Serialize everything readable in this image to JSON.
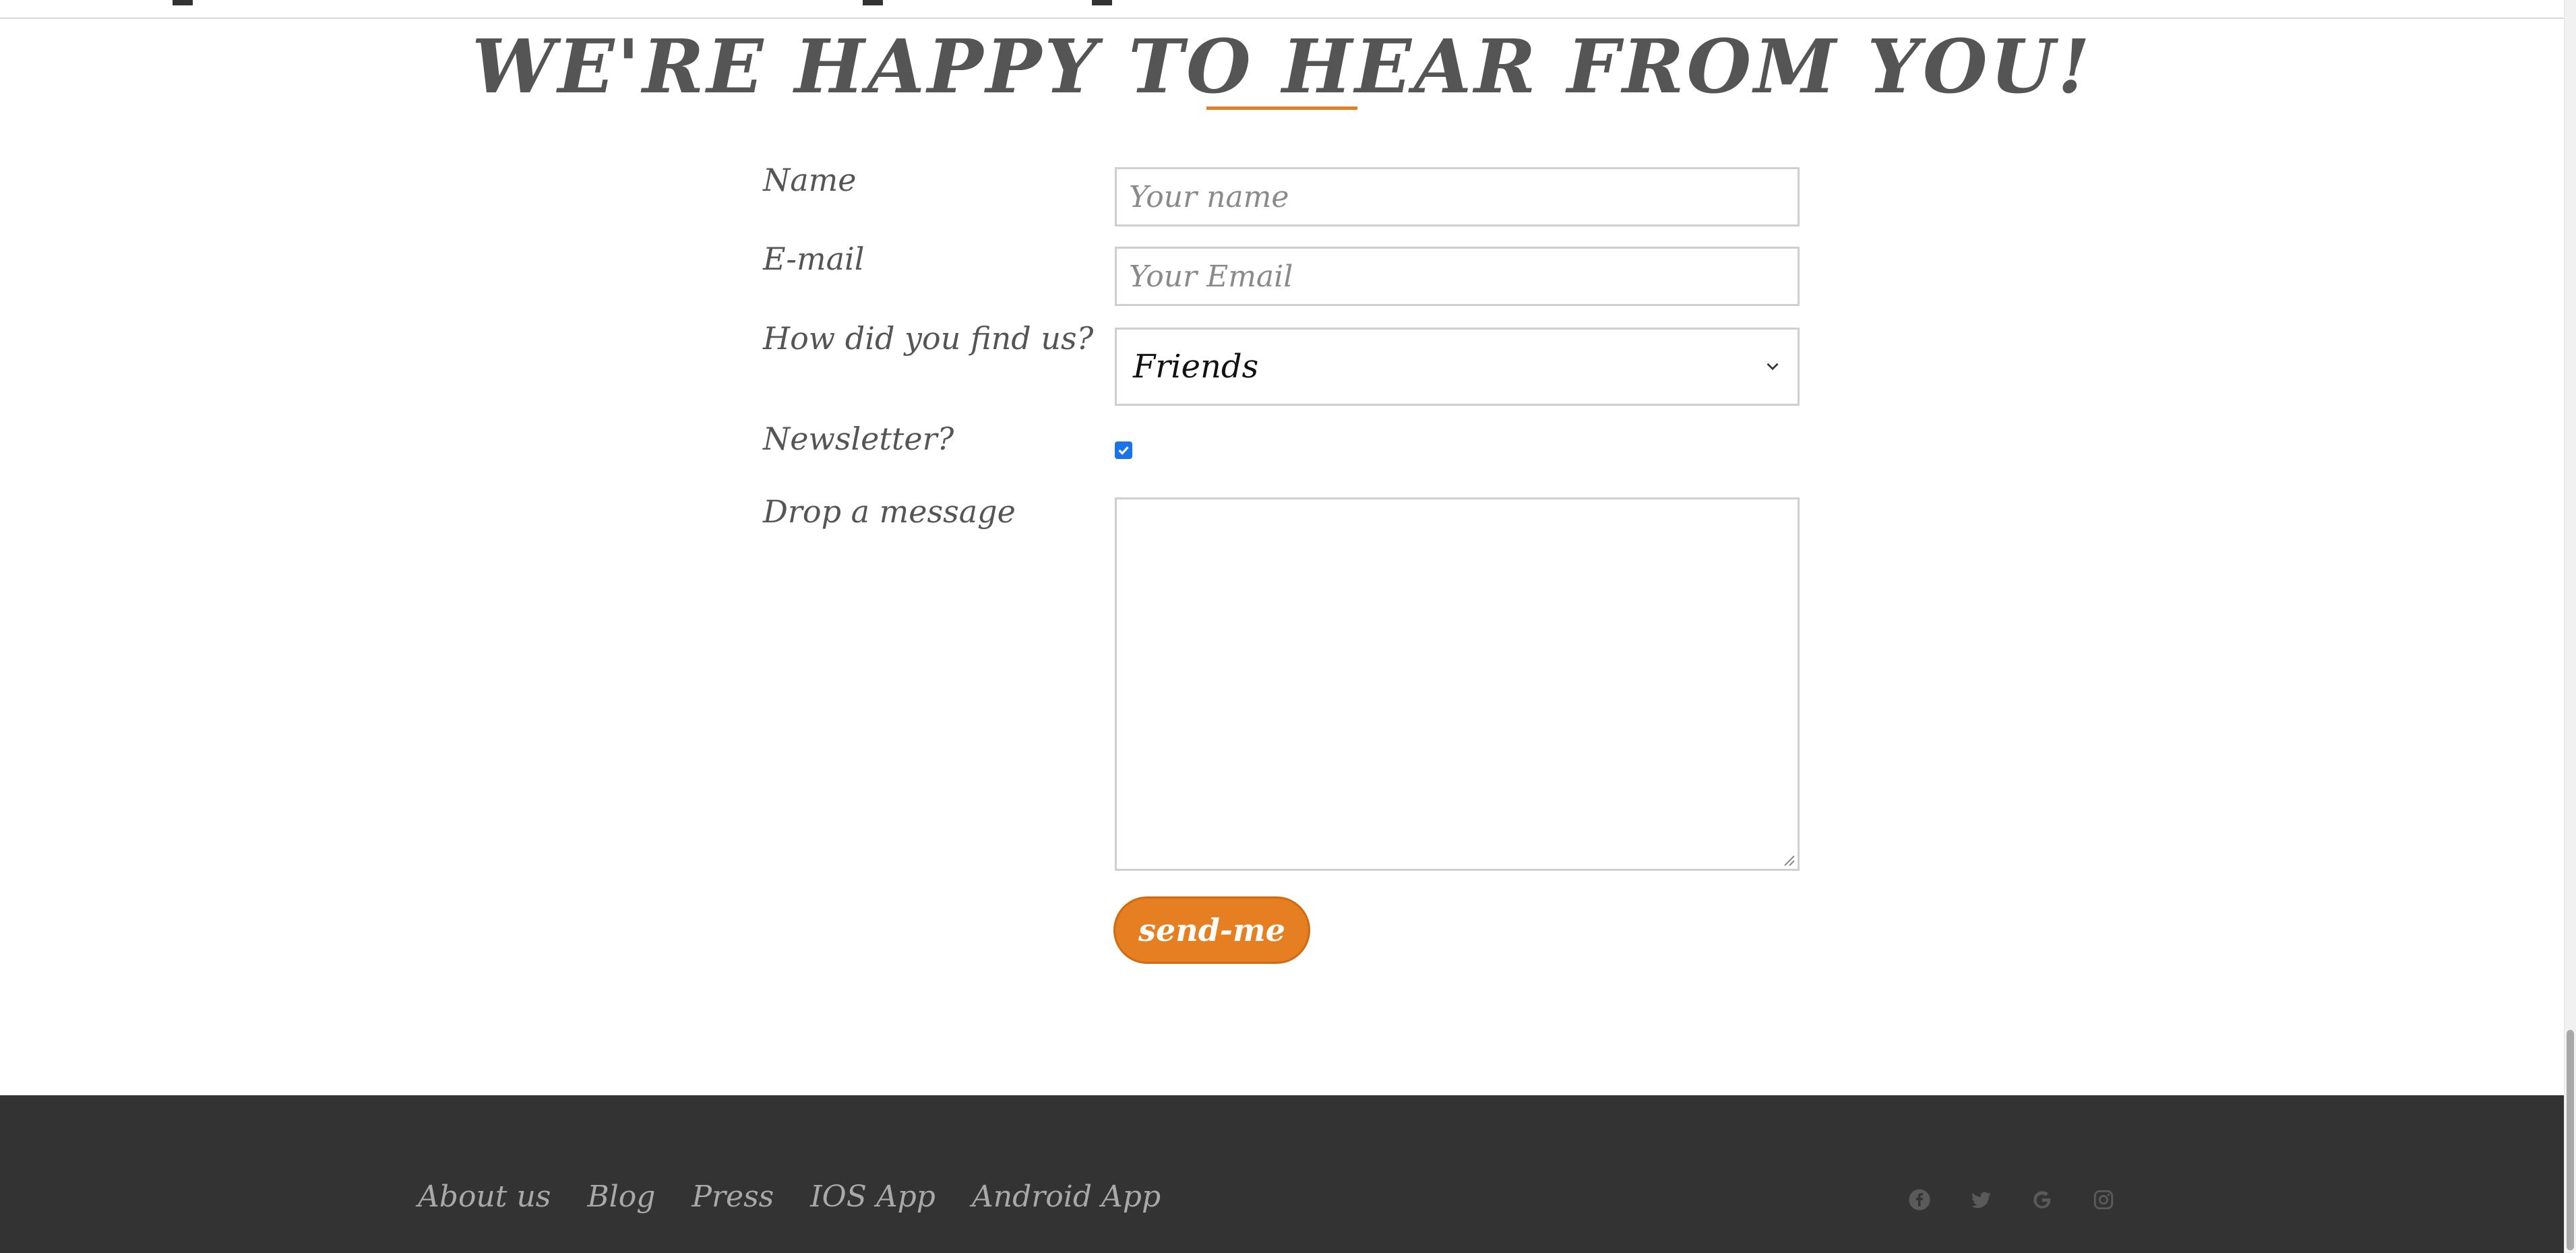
{
  "page": {
    "title": "WE'RE HAPPY TO HEAR FROM YOU!"
  },
  "form": {
    "name_label": "Name",
    "name_placeholder": "Your name",
    "email_label": "E-mail",
    "email_placeholder": "Your Email",
    "source_label": "How did you find us?",
    "source_selected": "Friends",
    "newsletter_label": "Newsletter?",
    "newsletter_checked": true,
    "message_label": "Drop a message",
    "message_value": "",
    "submit_label": "send-me"
  },
  "footer": {
    "links": [
      "About us",
      "Blog",
      "Press",
      "IOS App",
      "Android App"
    ],
    "social_icons": [
      "facebook-icon",
      "twitter-icon",
      "google-icon",
      "instagram-icon"
    ]
  },
  "colors": {
    "accent": "#e67e22",
    "footer_bg": "#333333",
    "text": "#555555"
  }
}
